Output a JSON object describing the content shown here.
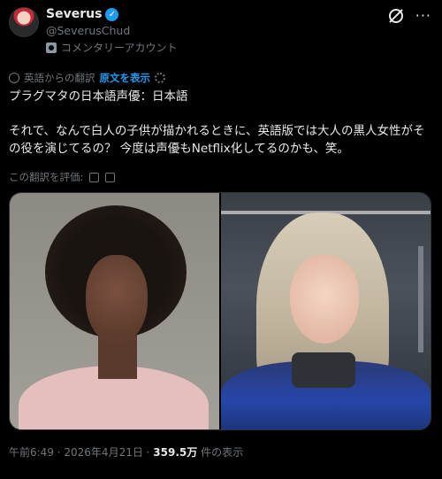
{
  "header": {
    "display_name": "Severus",
    "verified_mark": "✓",
    "handle": "@SeverusChud",
    "account_label": "コメンタリーアカウント",
    "more_glyph": "···"
  },
  "translation": {
    "label": "英語からの翻訳",
    "show_original": "原文を表示"
  },
  "tweet": {
    "text": "プラグマタの日本語声優：日本語\n\nそれで、なんで白人の子供が描かれるときに、英語版では大人の黒人女性がその役を演じてるの？ 今度は声優もNetflix化してるのかも、笑。"
  },
  "rating": {
    "label": "この翻訳を評価:"
  },
  "meta": {
    "time_date": "午前6:49 · 2026年4月21日 · ",
    "views_count": "359.5万",
    "views_label": " 件の表示"
  },
  "icons": {
    "verified": "verified-badge-icon",
    "grok": "grok-icon",
    "more": "more-icon",
    "translate": "translate-icon",
    "settings": "gear-icon",
    "thumbs_up": "thumbs-up-icon",
    "thumbs_down": "thumbs-down-icon",
    "commentary": "commentary-badge-icon"
  },
  "colors": {
    "background": "#000000",
    "text": "#e7e9ea",
    "muted": "#71767b",
    "accent": "#1d9bf0"
  }
}
